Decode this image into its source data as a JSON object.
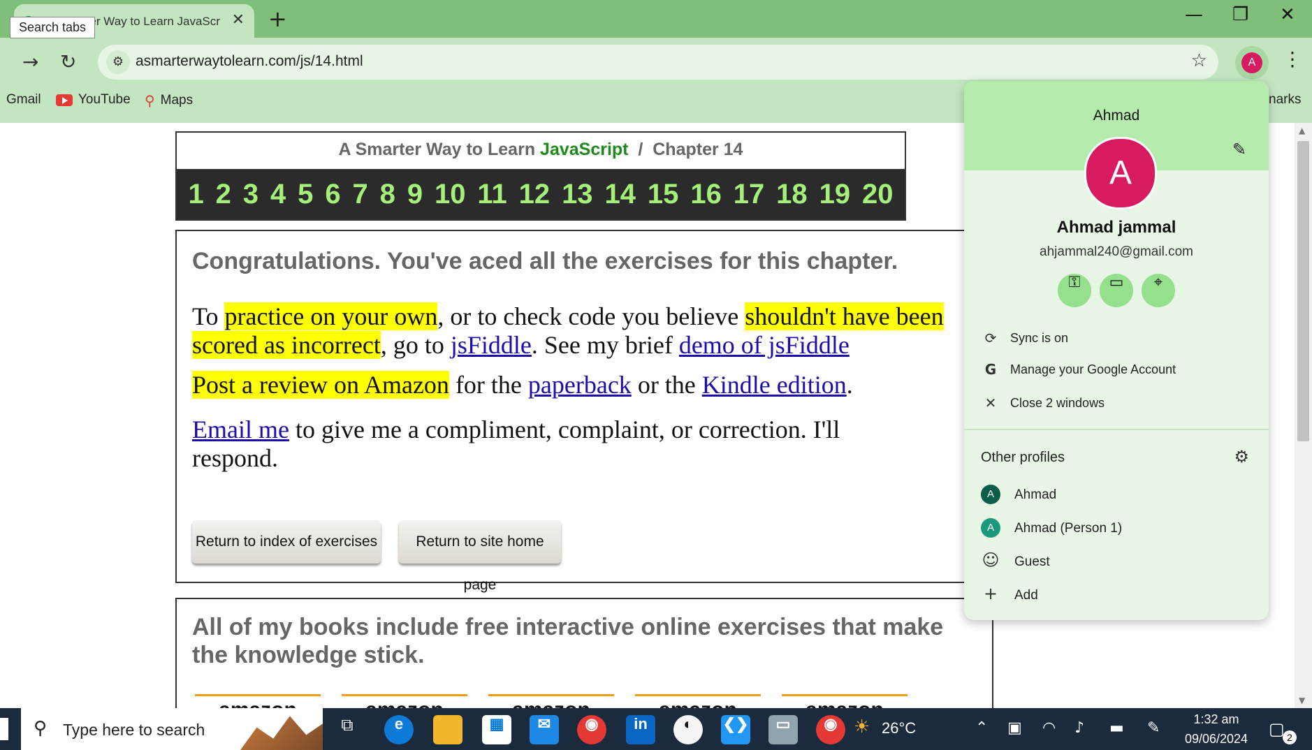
{
  "browser": {
    "tab_title": "A Smarter Way to Learn JavaScr",
    "tab_favicon": "S",
    "tooltip": "Search tabs",
    "new_tab": "+",
    "url": "asmarterwaytolearn.com/js/14.html",
    "profile_initial": "A",
    "bookmarks": [
      {
        "label": "Gmail"
      },
      {
        "label": "YouTube"
      },
      {
        "label": "Maps"
      }
    ],
    "bookmarks_right_fragment": "narks"
  },
  "page": {
    "header_prefix": "A Smarter Way to Learn ",
    "header_js": "JavaScript",
    "header_sep": "  /  ",
    "header_chapter": "Chapter 14",
    "chapters": [
      "1",
      "2",
      "3",
      "4",
      "5",
      "6",
      "7",
      "8",
      "9",
      "10",
      "11",
      "12",
      "13",
      "14",
      "15",
      "16",
      "17",
      "18",
      "19",
      "20"
    ],
    "congrats": "Congratulations. You've aced all the exercises for this chapter.",
    "p1": {
      "a": "To ",
      "hl1": "practice on your own",
      "b": ", or to check code you believe ",
      "hl2": "shouldn't have been scored as incorrect",
      "c": ", go to ",
      "link1": "jsFiddle",
      "d": ". See my brief ",
      "link2": "demo of jsFiddle"
    },
    "p2": {
      "hl": "Post a review on Amazon",
      "a": " for the ",
      "link1": "paperback",
      "b": " or the ",
      "link2": "Kindle edition",
      "c": "."
    },
    "p3": {
      "link": "Email me",
      "a": " to give me a compliment, complaint, or correction. I'll respond."
    },
    "btn_index": "Return to index of exercises",
    "btn_home": "Return to site home page",
    "books_text": "All of my books include free interactive online exercises that make the knowledge stick.",
    "amazon_label": "amazon"
  },
  "profile_popup": {
    "header_name": "Ahmad",
    "avatar_initial": "A",
    "full_name": "Ahmad jammal",
    "email": "ahjammal240@gmail.com",
    "menu": [
      {
        "icon": "sync-icon",
        "label": "Sync is on"
      },
      {
        "icon": "google-icon",
        "label": "Manage your Google Account"
      },
      {
        "icon": "close-icon",
        "label": "Close 2 windows"
      }
    ],
    "other_profiles_title": "Other profiles",
    "profiles": [
      {
        "initial": "A",
        "label": "Ahmad",
        "color": "#0b5e4a"
      },
      {
        "initial": "A",
        "label": "Ahmad (Person 1)",
        "color": "#1a9a7a"
      },
      {
        "initial": "",
        "label": "Guest"
      },
      {
        "initial": "",
        "label": "Add"
      }
    ],
    "header_color": "#b5ecad",
    "avatar_color": "#d81b60"
  },
  "taskbar": {
    "search_placeholder": "Type here to search",
    "weather": "26°C",
    "time": "1:32 am",
    "date": "09/06/2024",
    "notification_count": "2"
  }
}
